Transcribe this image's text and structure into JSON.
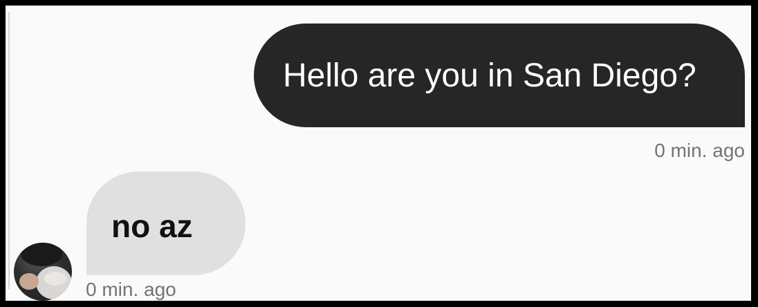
{
  "conversation": {
    "messages": [
      {
        "direction": "outgoing",
        "text": "Hello are you in San Diego?",
        "timestamp": "0 min. ago"
      },
      {
        "direction": "incoming",
        "text": "no az",
        "timestamp": "0 min. ago",
        "avatar": "user-avatar"
      }
    ]
  },
  "colors": {
    "outgoing_bubble": "#262626",
    "incoming_bubble": "#e0e0e0",
    "background": "#fafafa",
    "timestamp": "#737373"
  }
}
